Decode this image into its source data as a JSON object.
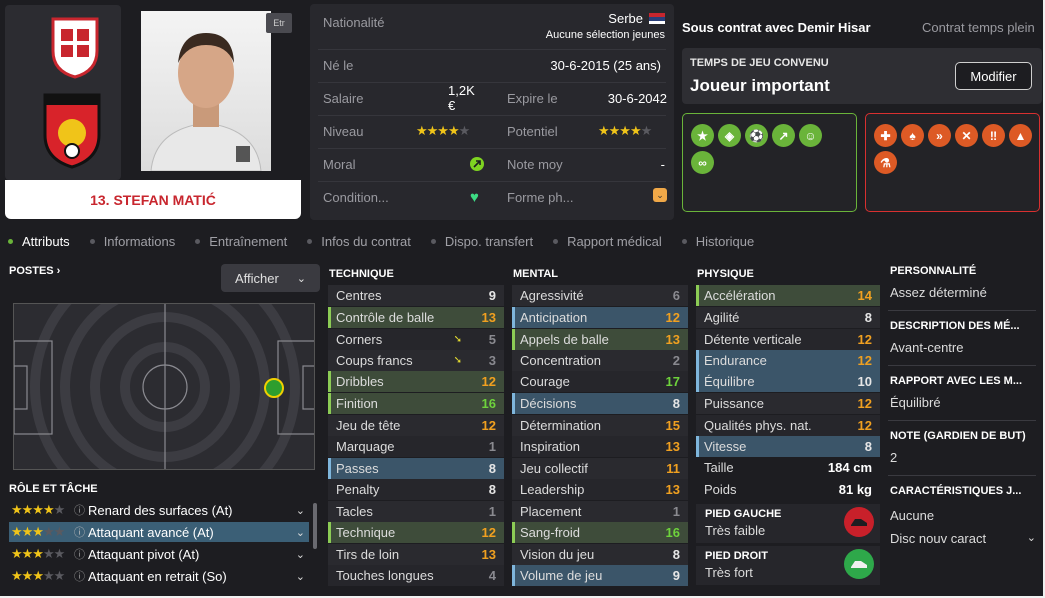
{
  "player": {
    "name": "13. STEFAN MATIĆ",
    "etr_label": "Etr"
  },
  "info": {
    "nationalite_label": "Nationalité",
    "nationalite_value": "Serbe",
    "selection_label": "Aucune sélection jeunes",
    "ne_le_label": "Né le",
    "ne_le_value": "30-6-2015 (25 ans)",
    "salaire_label": "Salaire",
    "salaire_value": "1,2K €",
    "expire_label": "Expire le",
    "expire_value": "30-6-2042",
    "niveau_label": "Niveau",
    "niveau_stars": 3.5,
    "potentiel_label": "Potentiel",
    "potentiel_stars": 4,
    "moral_label": "Moral",
    "note_label": "Note moy",
    "note_value": "-",
    "condition_label": "Condition...",
    "forme_label": "Forme ph..."
  },
  "contract": {
    "title": "Sous contrat avec Demir Hisar",
    "type": "Contrat temps plein",
    "playtime_heading": "TEMPS DE JEU CONVENU",
    "playtime_value": "Joueur important",
    "modify_label": "Modifier"
  },
  "tabs": [
    "Attributs",
    "Informations",
    "Entraînement",
    "Infos du contrat",
    "Dispo. transfert",
    "Rapport médical",
    "Historique"
  ],
  "positions": {
    "heading": "POSTES",
    "afficher_label": "Afficher"
  },
  "roles": {
    "heading": "RÔLE ET TÂCHE",
    "items": [
      {
        "label": "Renard des surfaces (At)",
        "stars": 3.5
      },
      {
        "label": "Attaquant avancé (At)",
        "stars": 3
      },
      {
        "label": "Attaquant pivot (At)",
        "stars": 3
      },
      {
        "label": "Attaquant en retrait (So)",
        "stars": 2.5
      }
    ]
  },
  "technique": {
    "heading": "TECHNIQUE",
    "rows": [
      {
        "label": "Centres",
        "value": "9"
      },
      {
        "label": "Contrôle de balle",
        "value": "13"
      },
      {
        "label": "Corners",
        "value": "5"
      },
      {
        "label": "Coups francs",
        "value": "3"
      },
      {
        "label": "Dribbles",
        "value": "12"
      },
      {
        "label": "Finition",
        "value": "16"
      },
      {
        "label": "Jeu de tête",
        "value": "12"
      },
      {
        "label": "Marquage",
        "value": "1"
      },
      {
        "label": "Passes",
        "value": "8"
      },
      {
        "label": "Penalty",
        "value": "8"
      },
      {
        "label": "Tacles",
        "value": "1"
      },
      {
        "label": "Technique",
        "value": "12"
      },
      {
        "label": "Tirs de loin",
        "value": "13"
      },
      {
        "label": "Touches longues",
        "value": "4"
      }
    ]
  },
  "mental": {
    "heading": "MENTAL",
    "rows": [
      {
        "label": "Agressivité",
        "value": "6"
      },
      {
        "label": "Anticipation",
        "value": "12"
      },
      {
        "label": "Appels de balle",
        "value": "13"
      },
      {
        "label": "Concentration",
        "value": "2"
      },
      {
        "label": "Courage",
        "value": "17"
      },
      {
        "label": "Décisions",
        "value": "8"
      },
      {
        "label": "Détermination",
        "value": "15"
      },
      {
        "label": "Inspiration",
        "value": "13"
      },
      {
        "label": "Jeu collectif",
        "value": "11"
      },
      {
        "label": "Leadership",
        "value": "13"
      },
      {
        "label": "Placement",
        "value": "1"
      },
      {
        "label": "Sang-froid",
        "value": "16"
      },
      {
        "label": "Vision du jeu",
        "value": "8"
      },
      {
        "label": "Volume de jeu",
        "value": "9"
      }
    ]
  },
  "physique": {
    "heading": "PHYSIQUE",
    "rows": [
      {
        "label": "Accélération",
        "value": "14"
      },
      {
        "label": "Agilité",
        "value": "8"
      },
      {
        "label": "Détente verticale",
        "value": "12"
      },
      {
        "label": "Endurance",
        "value": "12"
      },
      {
        "label": "Équilibre",
        "value": "10"
      },
      {
        "label": "Puissance",
        "value": "12"
      },
      {
        "label": "Qualités phys. nat.",
        "value": "12"
      },
      {
        "label": "Vitesse",
        "value": "8"
      }
    ],
    "taille_label": "Taille",
    "taille_value": "184 cm",
    "poids_label": "Poids",
    "poids_value": "81 kg",
    "pied_gauche_label": "PIED GAUCHE",
    "pied_gauche_value": "Très faible",
    "pied_droit_label": "PIED DROIT",
    "pied_droit_value": "Très fort"
  },
  "side": {
    "personnalite_heading": "PERSONNALITÉ",
    "personnalite_value": "Assez déterminé",
    "description_heading": "DESCRIPTION DES MÉ...",
    "description_value": "Avant-centre",
    "rapport_heading": "RAPPORT AVEC LES M...",
    "rapport_value": "Équilibré",
    "note_gardien_heading": "NOTE (GARDIEN DE BUT)",
    "note_gardien_value": "2",
    "caract_heading": "CARACTÉRISTIQUES J...",
    "caract_value": "Aucune",
    "disc_label": "Disc nouv caract"
  },
  "colors": {
    "positive": "#6ab43a",
    "negative": "#dd5a25",
    "highlight_value": "#f0a020",
    "top_value": "#6ed23c"
  }
}
